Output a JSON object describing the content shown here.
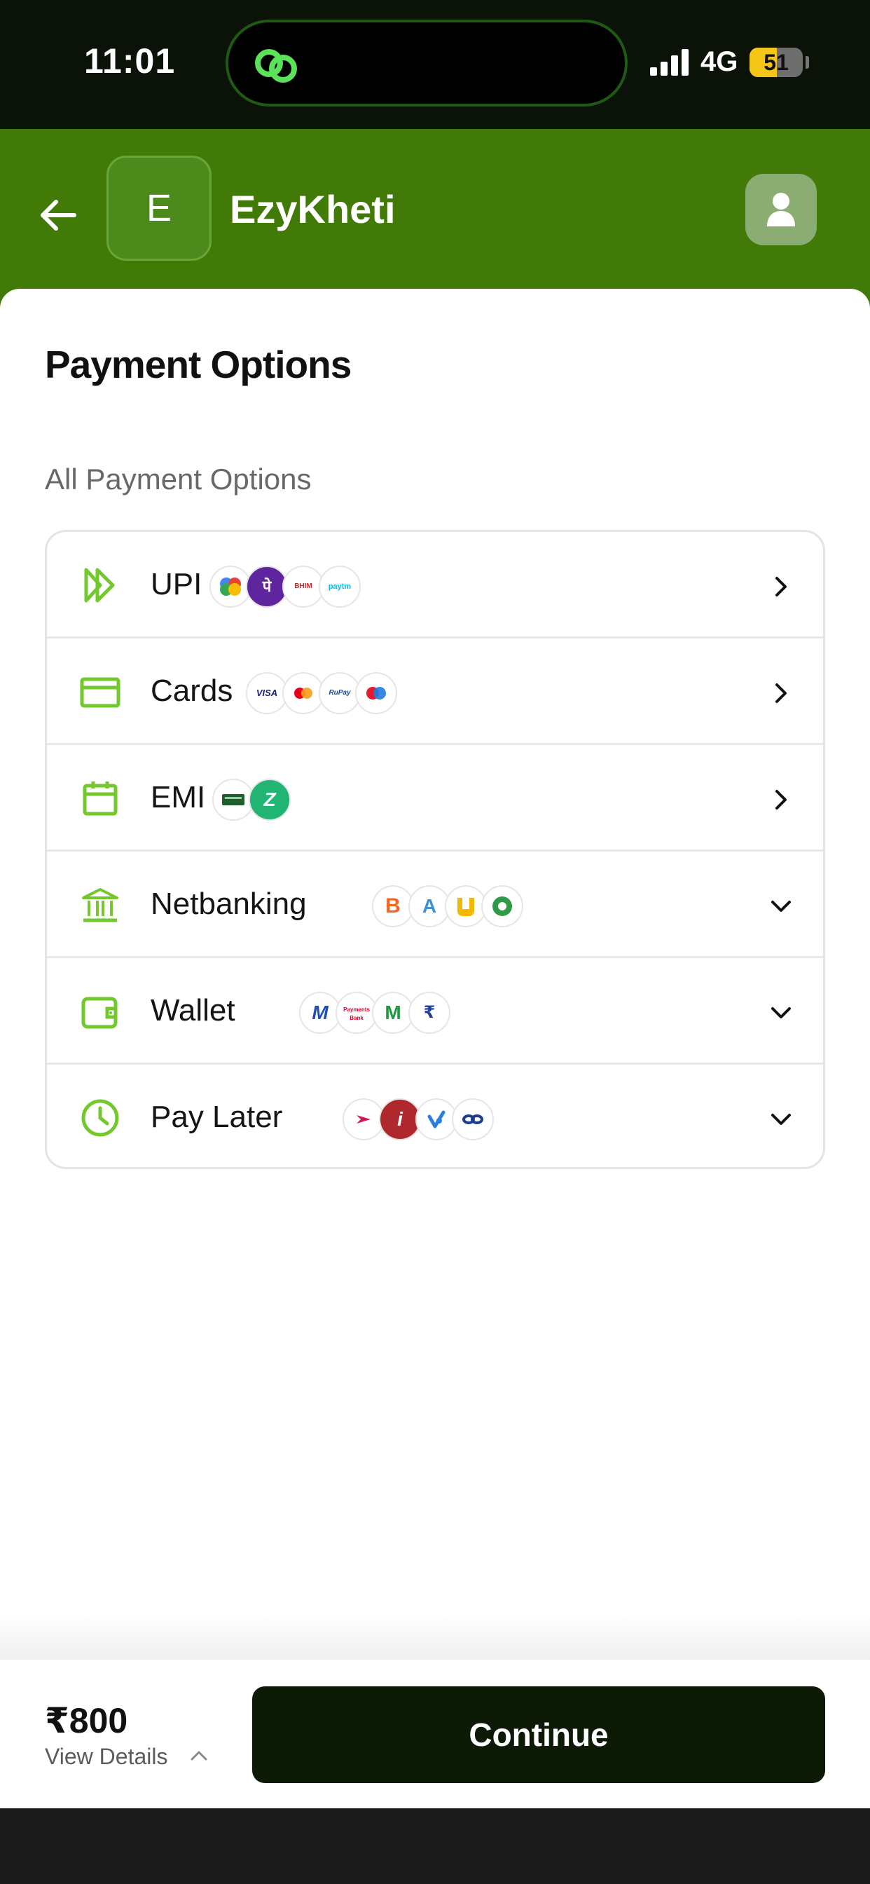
{
  "status_bar": {
    "time": "11:01",
    "network": "4G",
    "battery": "51",
    "battery_level": 0.51
  },
  "header": {
    "logo_letter": "E",
    "brand_name": "EzyKheti"
  },
  "page": {
    "title": "Payment Options",
    "section_label": "All Payment Options"
  },
  "payment_options": [
    {
      "label": "UPI",
      "icon": "upi-icon",
      "chevron": "right",
      "logos": [
        "google-pay-logo",
        "phonepe-logo",
        "bhim-logo",
        "paytm-logo"
      ],
      "logo_texts": [
        "",
        "पे",
        "BHIM",
        "paytm"
      ]
    },
    {
      "label": "Cards",
      "icon": "card-icon",
      "chevron": "right",
      "logos": [
        "visa-logo",
        "mastercard-logo",
        "rupay-logo",
        "maestro-logo"
      ],
      "logo_texts": [
        "VISA",
        "",
        "RuPay",
        ""
      ]
    },
    {
      "label": "EMI",
      "icon": "calendar-icon",
      "chevron": "right",
      "logos": [
        "card-emi-logo",
        "zestmoney-logo"
      ],
      "logo_texts": [
        "",
        "Z"
      ]
    },
    {
      "label": "Netbanking",
      "icon": "bank-icon",
      "chevron": "down",
      "logos": [
        "bank-of-baroda-logo",
        "axis-bank-logo",
        "punjab-national-bank-logo",
        "sbi-logo"
      ],
      "logo_texts": [
        "B",
        "A",
        "",
        ""
      ]
    },
    {
      "label": "Wallet",
      "icon": "wallet-icon",
      "chevron": "down",
      "logos": [
        "mobikwik-logo",
        "airtel-payments-bank-logo",
        "mpesa-logo",
        "jio-money-logo"
      ],
      "logo_texts": [
        "M",
        "Payments Bank",
        "M",
        "₹"
      ]
    },
    {
      "label": "Pay Later",
      "icon": "clock-icon",
      "chevron": "down",
      "logos": [
        "lazypay-logo",
        "icici-paylater-logo",
        "simpl-logo",
        "zestmoney-paylater-logo"
      ],
      "logo_texts": [
        "",
        "i",
        "",
        ""
      ]
    }
  ],
  "footer": {
    "amount": "₹800",
    "view_details": "View Details",
    "continue_label": "Continue"
  },
  "colors": {
    "header_green": "#417a07",
    "icon_green": "#72c82c",
    "button_dark": "#0d1a06"
  }
}
